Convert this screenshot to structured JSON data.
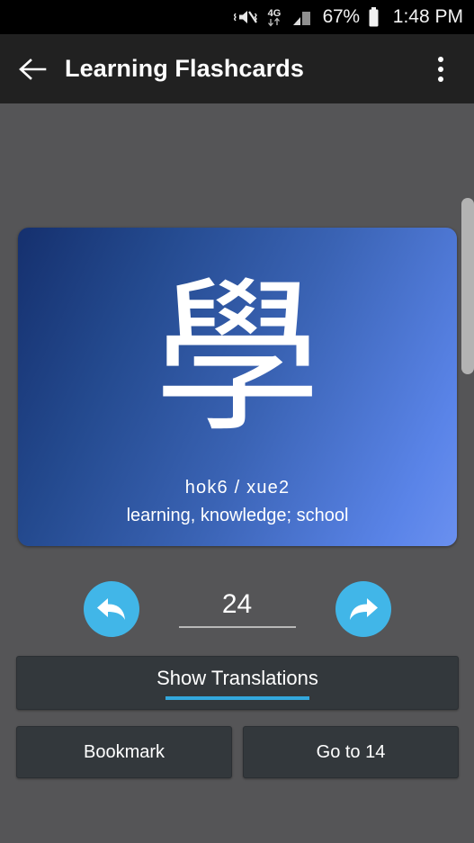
{
  "status_bar": {
    "vibrate_icon": "vibrate-mute-icon",
    "network_label": "4G",
    "signal_icon": "signal-bars-icon",
    "battery_percent": "67%",
    "battery_icon": "battery-icon",
    "time": "1:48 PM"
  },
  "toolbar": {
    "back_icon": "arrow-left-icon",
    "title": "Learning Flashcards",
    "overflow_icon": "more-vertical-icon"
  },
  "card": {
    "character": "學",
    "reading": "hok6  /  xue2",
    "meaning": "learning, knowledge; school",
    "gradient_from": "#15306e",
    "gradient_to": "#6a90f0"
  },
  "navigation": {
    "previous_icon": "arrow-undo-back-icon",
    "next_icon": "arrow-redo-forward-icon",
    "index_value": "24",
    "accent_color": "#41b6e8"
  },
  "actions": {
    "show_translations": "Show Translations",
    "show_translations_accent": "#33a8dd",
    "bookmark": "Bookmark",
    "go_to": "Go to 14"
  },
  "scrollbar": {
    "thumb_color": "#b3b3b3"
  }
}
